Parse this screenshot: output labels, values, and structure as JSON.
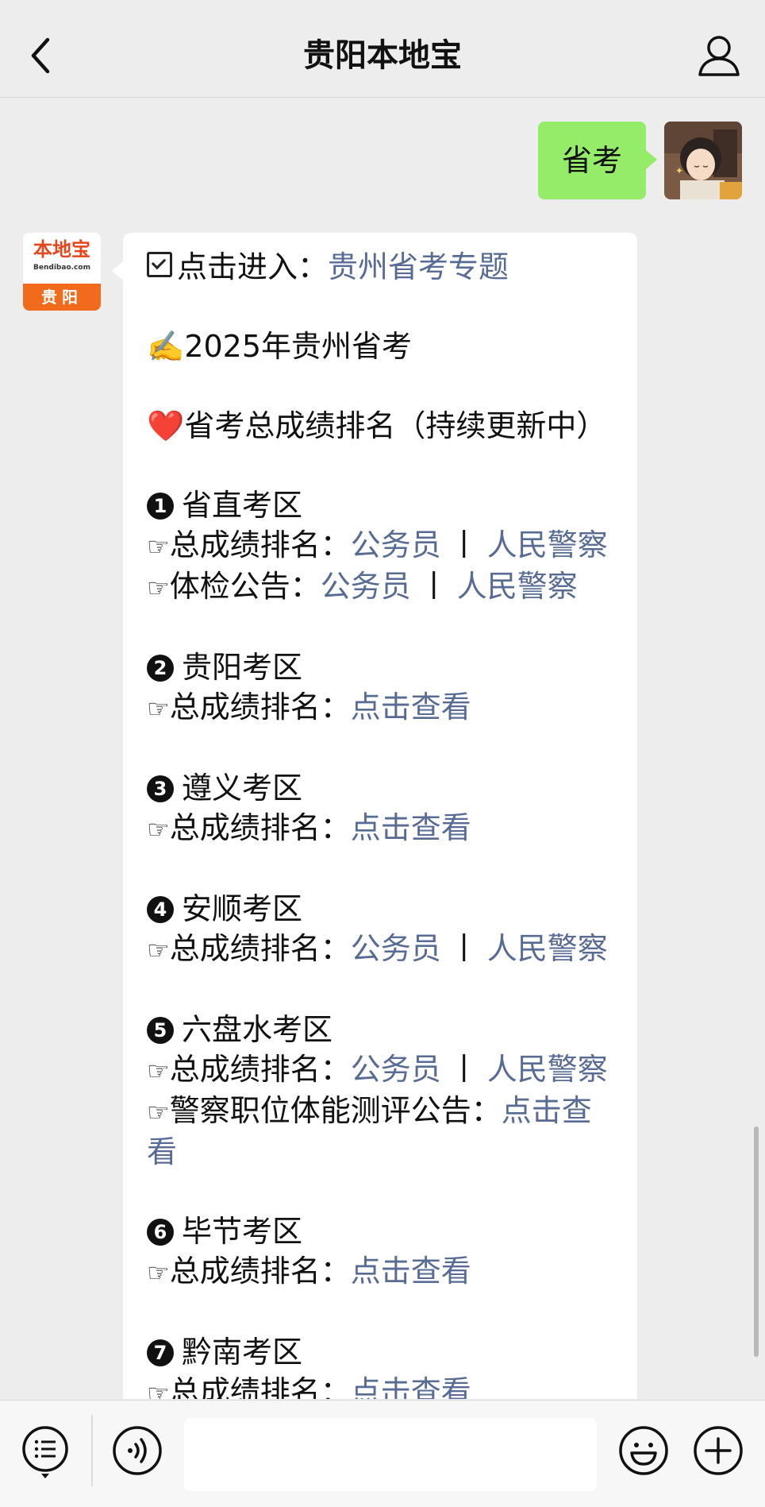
{
  "header": {
    "title": "贵阳本地宝"
  },
  "my_message": {
    "text": "省考"
  },
  "avatar": {
    "bottom_label": "贵阳",
    "top_label": "本地宝",
    "sub_label": "Bendibao.com"
  },
  "article": {
    "entry": {
      "label": "点击进入：",
      "link": "贵州省考专题"
    },
    "year_line": {
      "emoji": "✍️",
      "text": "2025年贵州省考"
    },
    "rank_line": {
      "emoji": "❤️",
      "text": "省考总成绩排名（持续更新中）"
    },
    "sections": [
      {
        "num": "1",
        "title": "省直考区",
        "rows": [
          {
            "label": "总成绩排名：",
            "links": [
              "公务员",
              "人民警察"
            ]
          },
          {
            "label": "体检公告：",
            "links": [
              "公务员",
              "人民警察"
            ]
          }
        ]
      },
      {
        "num": "2",
        "title": "贵阳考区",
        "rows": [
          {
            "label": "总成绩排名：",
            "links": [
              "点击查看"
            ]
          }
        ]
      },
      {
        "num": "3",
        "title": "遵义考区",
        "rows": [
          {
            "label": "总成绩排名：",
            "links": [
              "点击查看"
            ]
          }
        ]
      },
      {
        "num": "4",
        "title": "安顺考区",
        "rows": [
          {
            "label": "总成绩排名：",
            "links": [
              "公务员",
              "人民警察"
            ]
          }
        ]
      },
      {
        "num": "5",
        "title": "六盘水考区",
        "rows": [
          {
            "label": "总成绩排名：",
            "links": [
              "公务员",
              "人民警察"
            ]
          },
          {
            "label": "警察职位体能测评公告：",
            "links": [
              "点击查看"
            ]
          }
        ]
      },
      {
        "num": "6",
        "title": "毕节考区",
        "rows": [
          {
            "label": "总成绩排名：",
            "links": [
              "点击查看"
            ]
          }
        ]
      },
      {
        "num": "7",
        "title": "黔南考区",
        "rows": [
          {
            "label": "总成绩排名：",
            "links": [
              "点击查看"
            ]
          }
        ]
      }
    ],
    "separator": "丨",
    "pointer": "☞"
  },
  "input": {
    "value": ""
  },
  "colors": {
    "link": "#576b95",
    "bubble_mine": "#95ec69",
    "background": "#ededed",
    "logo_orange": "#f26a1b"
  }
}
